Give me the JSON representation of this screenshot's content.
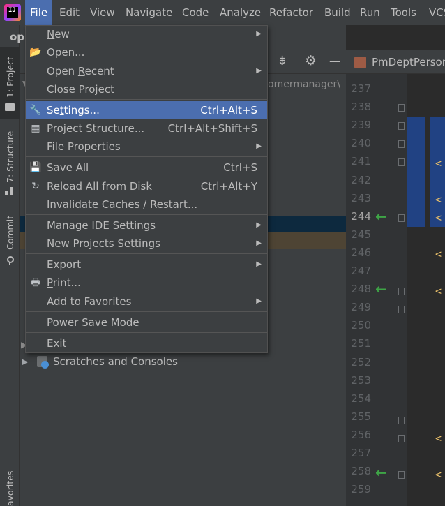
{
  "menubar": {
    "items": [
      "File",
      "Edit",
      "View",
      "Navigate",
      "Code",
      "Analyze",
      "Refactor",
      "Build",
      "Run",
      "Tools",
      "VCS"
    ],
    "mnemonics": [
      "F",
      "E",
      "V",
      "N",
      "C",
      "",
      "R",
      "B",
      "u",
      "T",
      ""
    ]
  },
  "left_stripe": {
    "project_tab": "1: Project",
    "structure_tab": "7: Structure",
    "commit_tab": "Commit",
    "favorites_tab": "avorites"
  },
  "project_panel": {
    "title": "op",
    "path_fragment": "omermanager\\",
    "scratches_label": "Scratches and Consoles"
  },
  "editor": {
    "tab_title": "PmDeptPerson",
    "line_numbers": [
      "237",
      "238",
      "239",
      "240",
      "241",
      "242",
      "243",
      "244",
      "245",
      "246",
      "247",
      "248",
      "249",
      "250",
      "251",
      "252",
      "253",
      "254",
      "255",
      "256",
      "257",
      "258",
      "259"
    ],
    "current_line": "244",
    "tag_glyph": "<"
  },
  "file_menu": {
    "items": [
      {
        "label": "New",
        "shortcut": "",
        "submenu": true,
        "icon": ""
      },
      {
        "label": "Open...",
        "shortcut": "",
        "submenu": false,
        "icon": "folder-open-icon"
      },
      {
        "label": "Open Recent",
        "shortcut": "",
        "submenu": true,
        "icon": ""
      },
      {
        "label": "Close Project",
        "shortcut": "",
        "submenu": false,
        "icon": ""
      },
      {
        "label": "Settings...",
        "shortcut": "Ctrl+Alt+S",
        "submenu": false,
        "icon": "wrench-icon"
      },
      {
        "label": "Project Structure...",
        "shortcut": "Ctrl+Alt+Shift+S",
        "submenu": false,
        "icon": "project-structure-icon"
      },
      {
        "label": "File Properties",
        "shortcut": "",
        "submenu": true,
        "icon": ""
      },
      {
        "label": "Save All",
        "shortcut": "Ctrl+S",
        "submenu": false,
        "icon": "save-icon"
      },
      {
        "label": "Reload All from Disk",
        "shortcut": "Ctrl+Alt+Y",
        "submenu": false,
        "icon": "reload-icon"
      },
      {
        "label": "Invalidate Caches / Restart...",
        "shortcut": "",
        "submenu": false,
        "icon": ""
      },
      {
        "label": "Manage IDE Settings",
        "shortcut": "",
        "submenu": true,
        "icon": ""
      },
      {
        "label": "New Projects Settings",
        "shortcut": "",
        "submenu": true,
        "icon": ""
      },
      {
        "label": "Export",
        "shortcut": "",
        "submenu": true,
        "icon": ""
      },
      {
        "label": "Print...",
        "shortcut": "",
        "submenu": false,
        "icon": "print-icon"
      },
      {
        "label": "Add to Favorites",
        "shortcut": "",
        "submenu": true,
        "icon": ""
      },
      {
        "label": "Power Save Mode",
        "shortcut": "",
        "submenu": false,
        "icon": ""
      },
      {
        "label": "Exit",
        "shortcut": "",
        "submenu": false,
        "icon": ""
      }
    ],
    "selected": "Settings...",
    "submenu_arrow": "▶"
  },
  "toolbar": {
    "collapse_glyph": "⇟",
    "gear_glyph": "⚙",
    "hide_glyph": "—"
  },
  "colors": {
    "menu_bg": "#3c3f41",
    "selection": "#4b6eaf",
    "editor_bg": "#2b2b2b",
    "code_selection": "#214283",
    "tag_color": "#e8bf6a",
    "change_arrow": "#3ea546"
  }
}
